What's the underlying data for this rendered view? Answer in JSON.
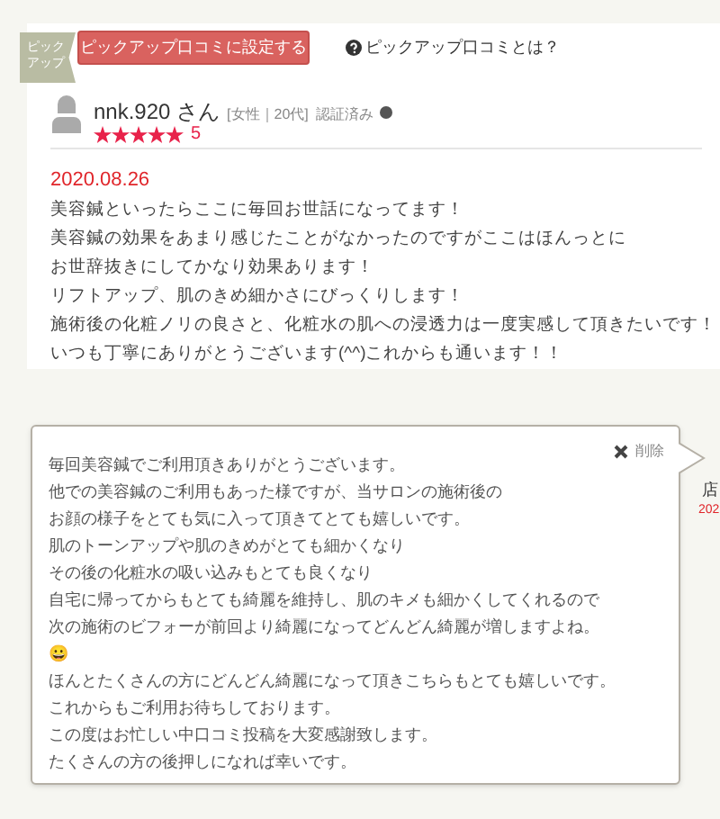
{
  "pickup_badge": "ピックアップ",
  "pickup_button": "ピックアップ口コミに設定する",
  "pickup_help": "ピックアップ口コミとは？",
  "reviewer": {
    "name": "nnk.920 さん",
    "attributes": "[女性｜20代]",
    "verified_label": "認証済み",
    "verified": true,
    "stars": 5,
    "rating": "5"
  },
  "review": {
    "date": "2020.08.26",
    "lines": [
      "美容鍼といったらここに毎回お世話になってます！",
      "美容鍼の効果をあまり感じたことがなかったのですがここはほんっとに",
      "お世辞抜きにしてかなり効果あります！",
      "リフトアップ、肌のきめ細かさにびっくりします！",
      "施術後の化粧ノリの良さと、化粧水の肌への浸透力は一度実感して頂きたいです！",
      "いつも丁寧にありがとうございます(^^)これからも通います！！"
    ]
  },
  "reply": {
    "delete_label": "削除",
    "lines": [
      "毎回美容鍼でご利用頂きありがとうございます。",
      "他での美容鍼のご利用もあった様ですが、当サロンの施術後の",
      "お顔の様子をとても気に入って頂きてとても嬉しいです。",
      "肌のトーンアップや肌のきめがとても細かくなり",
      "その後の化粧水の吸い込みもとても良くなり",
      "自宅に帰ってからもとても綺麗を維持し、肌のキメも細かくしてくれるので",
      "次の施術のビフォーが前回より綺麗になってどんどん綺麗が増しますよね。",
      "😀",
      "ほんとたくさんの方にどんどん綺麗になって頂きこちらもとても嬉しいです。",
      "これからもご利用お待ちしております。",
      "この度はお忙しい中口コミ投稿を大変感謝致します。",
      "たくさんの方の後押しになれば幸いです。"
    ]
  },
  "shop": {
    "name": "店",
    "date": "202"
  }
}
